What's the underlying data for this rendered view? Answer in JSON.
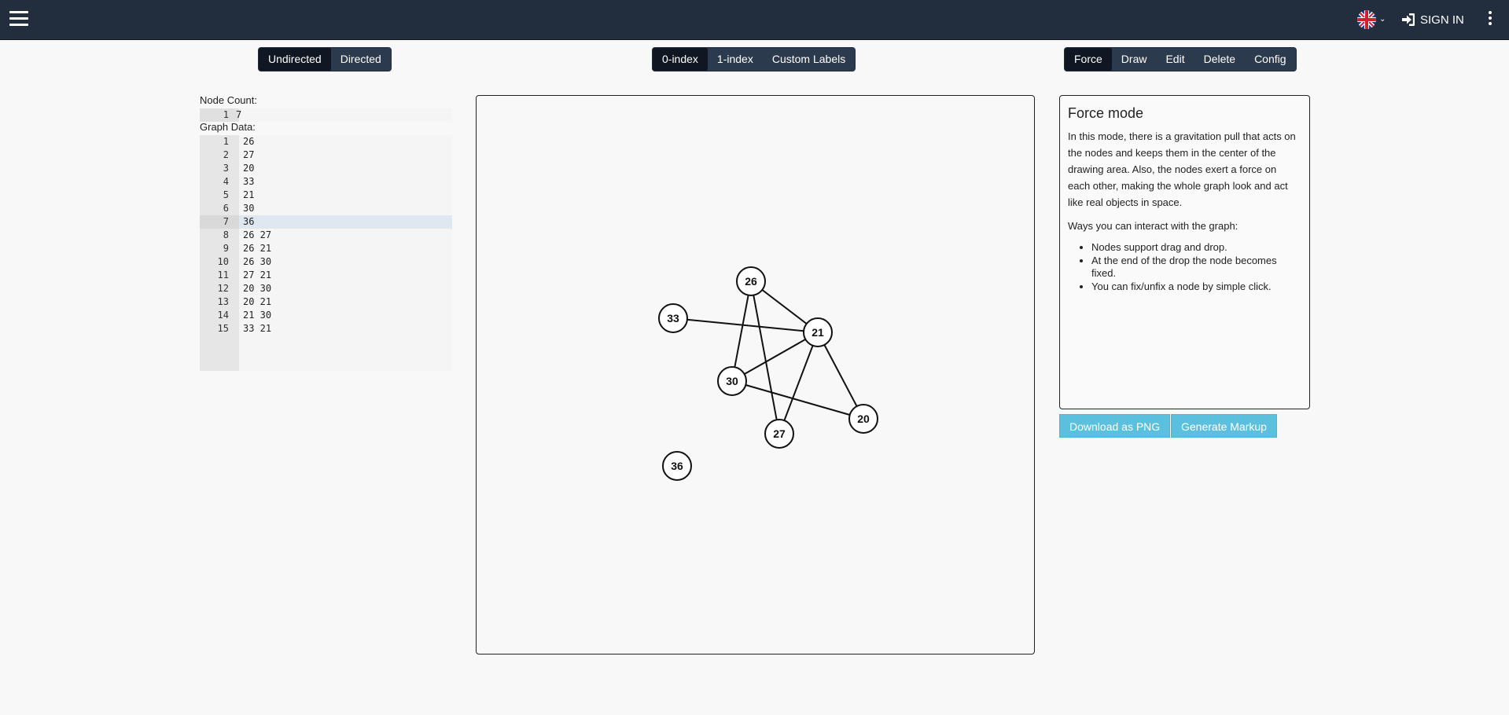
{
  "header": {
    "menu_icon": "hamburger-icon",
    "language_icon": "uk-flag-icon",
    "signin_label": "SIGN IN",
    "more_icon": "kebab-icon"
  },
  "graph_type": {
    "options": [
      "Undirected",
      "Directed"
    ],
    "active": "Undirected"
  },
  "indexing": {
    "options": [
      "0-index",
      "1-index",
      "Custom Labels"
    ],
    "active": "0-index"
  },
  "modes": {
    "options": [
      "Force",
      "Draw",
      "Edit",
      "Delete",
      "Config"
    ],
    "active": "Force"
  },
  "editor": {
    "node_count_label": "Node Count:",
    "node_count": {
      "num": "1",
      "value": "7"
    },
    "graph_data_label": "Graph Data:",
    "lines": [
      {
        "num": "1",
        "text": "26"
      },
      {
        "num": "2",
        "text": "27"
      },
      {
        "num": "3",
        "text": "20"
      },
      {
        "num": "4",
        "text": "33"
      },
      {
        "num": "5",
        "text": "21"
      },
      {
        "num": "6",
        "text": "30"
      },
      {
        "num": "7",
        "text": "36"
      },
      {
        "num": "8",
        "text": "26 27"
      },
      {
        "num": "9",
        "text": "26 21"
      },
      {
        "num": "10",
        "text": "26 30"
      },
      {
        "num": "11",
        "text": "27 21"
      },
      {
        "num": "12",
        "text": "20 30"
      },
      {
        "num": "13",
        "text": "20 21"
      },
      {
        "num": "14",
        "text": "21 30"
      },
      {
        "num": "15",
        "text": "33 21"
      }
    ],
    "active_line": "7"
  },
  "graph": {
    "nodes": [
      "26",
      "33",
      "21",
      "30",
      "20",
      "27",
      "36"
    ],
    "edges": [
      [
        "26",
        "27"
      ],
      [
        "26",
        "21"
      ],
      [
        "26",
        "30"
      ],
      [
        "27",
        "21"
      ],
      [
        "20",
        "30"
      ],
      [
        "20",
        "21"
      ],
      [
        "21",
        "30"
      ],
      [
        "33",
        "21"
      ]
    ]
  },
  "panel": {
    "title": "Force mode",
    "paragraph1": "In this mode, there is a gravitation pull that acts on the nodes and keeps them in the center of the drawing area. Also, the nodes exert a force on each other, making the whole graph look and act like real objects in space.",
    "paragraph2": "Ways you can interact with the graph:",
    "bullets": [
      "Nodes support drag and drop.",
      "At the end of the drop the node becomes fixed.",
      "You can fix/unfix a node by simple click."
    ]
  },
  "actions": {
    "download_label": "Download as PNG",
    "markup_label": "Generate Markup"
  },
  "colors": {
    "navbar": "#222d3d",
    "action_button": "#5bc0de",
    "background": "#f8f8f8"
  }
}
